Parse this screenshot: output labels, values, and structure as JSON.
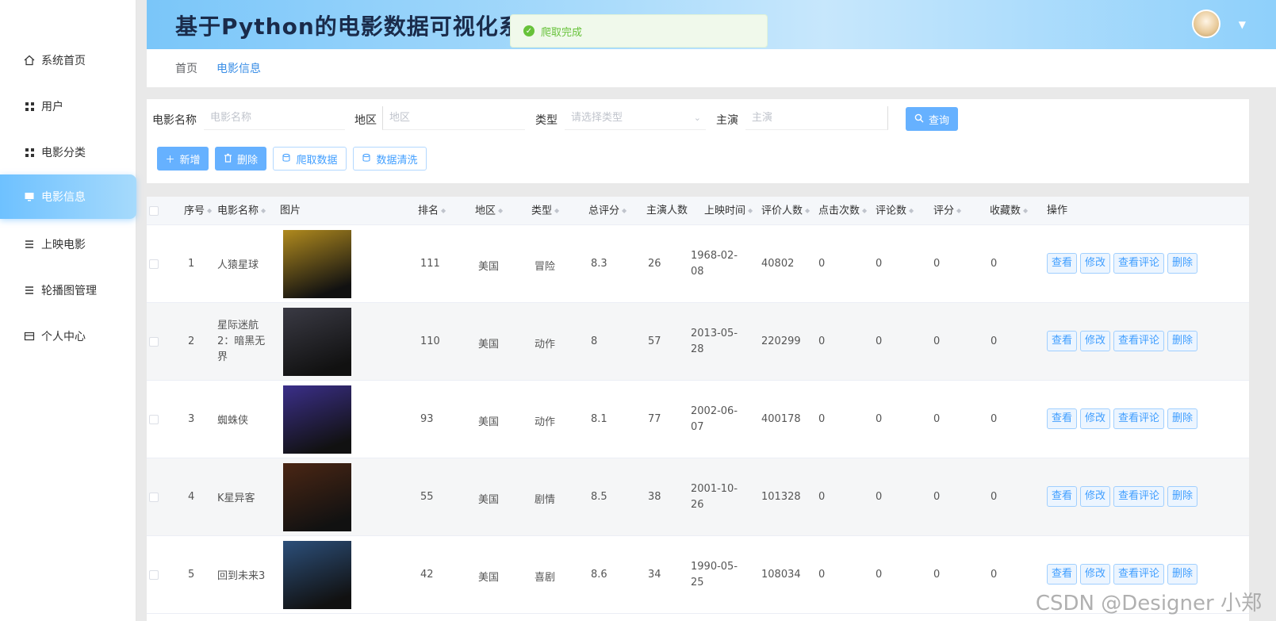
{
  "app": {
    "title": "基于Python的电影数据可视化系统设计与实现",
    "toast": "爬取完成"
  },
  "sidebar": {
    "items": [
      {
        "label": "系统首页",
        "icon": "home-icon"
      },
      {
        "label": "用户",
        "icon": "grid-icon"
      },
      {
        "label": "电影分类",
        "icon": "grid-icon"
      },
      {
        "label": "电影信息",
        "icon": "monitor-icon"
      },
      {
        "label": "上映电影",
        "icon": "list-icon"
      },
      {
        "label": "轮播图管理",
        "icon": "list-icon"
      },
      {
        "label": "个人中心",
        "icon": "card-icon"
      }
    ],
    "active_index": 3
  },
  "breadcrumb": {
    "home": "首页",
    "current": "电影信息"
  },
  "filters": {
    "name_label": "电影名称",
    "name_placeholder": "电影名称",
    "region_label": "地区",
    "region_placeholder": "地区",
    "type_label": "类型",
    "type_placeholder": "请选择类型",
    "actor_label": "主演",
    "actor_placeholder": "主演",
    "search_label": "查询"
  },
  "toolbar": {
    "add_label": "新增",
    "delete_label": "删除",
    "crawl_label": "爬取数据",
    "clean_label": "数据清洗"
  },
  "table": {
    "headers": [
      "序号",
      "电影名称",
      "图片",
      "排名",
      "地区",
      "类型",
      "总评分",
      "主演人数",
      "上映时间",
      "评价人数",
      "点击次数",
      "评论数",
      "评分",
      "收藏数",
      "操作"
    ],
    "ops": [
      "查看",
      "修改",
      "查看评论",
      "删除"
    ],
    "rows": [
      {
        "idx": "1",
        "name": "人猿星球",
        "rank": "111",
        "region": "美国",
        "type": "冒险",
        "score": "8.3",
        "actors": "26",
        "date": "1968-02-08",
        "reviews": "40802",
        "clicks": "0",
        "comments": "0",
        "rating": "0",
        "favs": "0",
        "poster": "#b08a1e"
      },
      {
        "idx": "2",
        "name": "星际迷航2：暗黑无界",
        "rank": "110",
        "region": "美国",
        "type": "动作",
        "score": "8",
        "actors": "57",
        "date": "2013-05-28",
        "reviews": "220299",
        "clicks": "0",
        "comments": "0",
        "rating": "0",
        "favs": "0",
        "poster": "#3a3a44"
      },
      {
        "idx": "3",
        "name": "蜘蛛侠",
        "rank": "93",
        "region": "美国",
        "type": "动作",
        "score": "8.1",
        "actors": "77",
        "date": "2002-06-07",
        "reviews": "400178",
        "clicks": "0",
        "comments": "0",
        "rating": "0",
        "favs": "0",
        "poster": "#3b2f8a"
      },
      {
        "idx": "4",
        "name": "K星异客",
        "rank": "55",
        "region": "美国",
        "type": "剧情",
        "score": "8.5",
        "actors": "38",
        "date": "2001-10-26",
        "reviews": "101328",
        "clicks": "0",
        "comments": "0",
        "rating": "0",
        "favs": "0",
        "poster": "#4a2614"
      },
      {
        "idx": "5",
        "name": "回到未来3",
        "rank": "42",
        "region": "美国",
        "type": "喜剧",
        "score": "8.6",
        "actors": "34",
        "date": "1990-05-25",
        "reviews": "108034",
        "clicks": "0",
        "comments": "0",
        "rating": "0",
        "favs": "0",
        "poster": "#2c4f7a"
      }
    ]
  },
  "watermark": "CSDN @Designer 小郑"
}
